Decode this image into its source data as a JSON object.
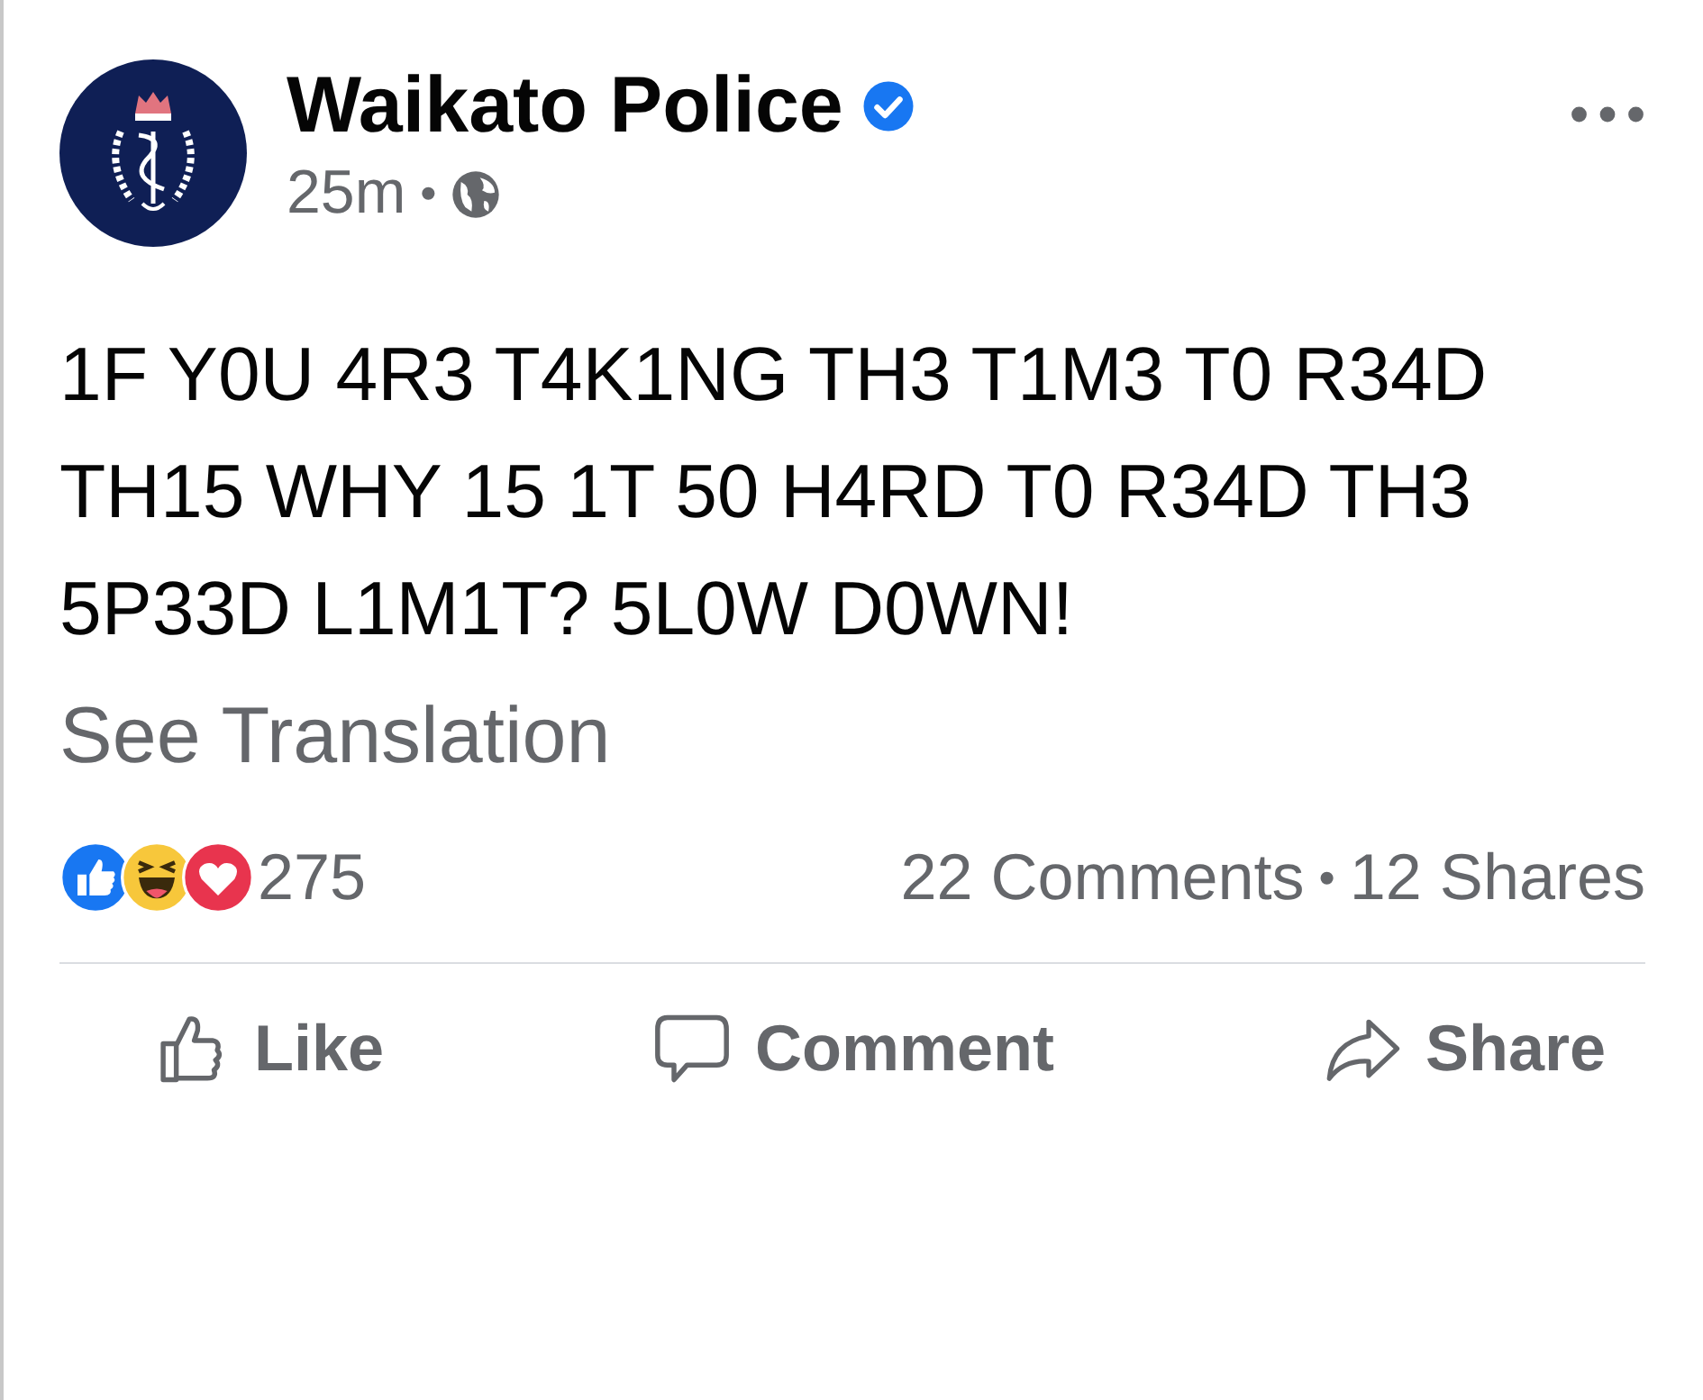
{
  "post": {
    "author": "Waikato Police",
    "verified": true,
    "time": "25m",
    "separator": "•",
    "body": "1F Y0U 4R3 T4K1NG TH3 T1M3 T0 R34D TH15 WHY 15 1T 50 H4RD T0 R34D TH3 5P33D L1M1T? 5L0W D0WN!",
    "translation_link": "See Translation"
  },
  "reactions": {
    "icons": [
      {
        "kind": "like"
      },
      {
        "kind": "haha"
      },
      {
        "kind": "love"
      }
    ],
    "count": "275"
  },
  "stats": {
    "comments": "22 Comments",
    "separator": "•",
    "shares": "12 Shares"
  },
  "actions": [
    {
      "kind": "like",
      "label": "Like"
    },
    {
      "kind": "comment",
      "label": "Comment"
    },
    {
      "kind": "share",
      "label": "Share"
    }
  ]
}
